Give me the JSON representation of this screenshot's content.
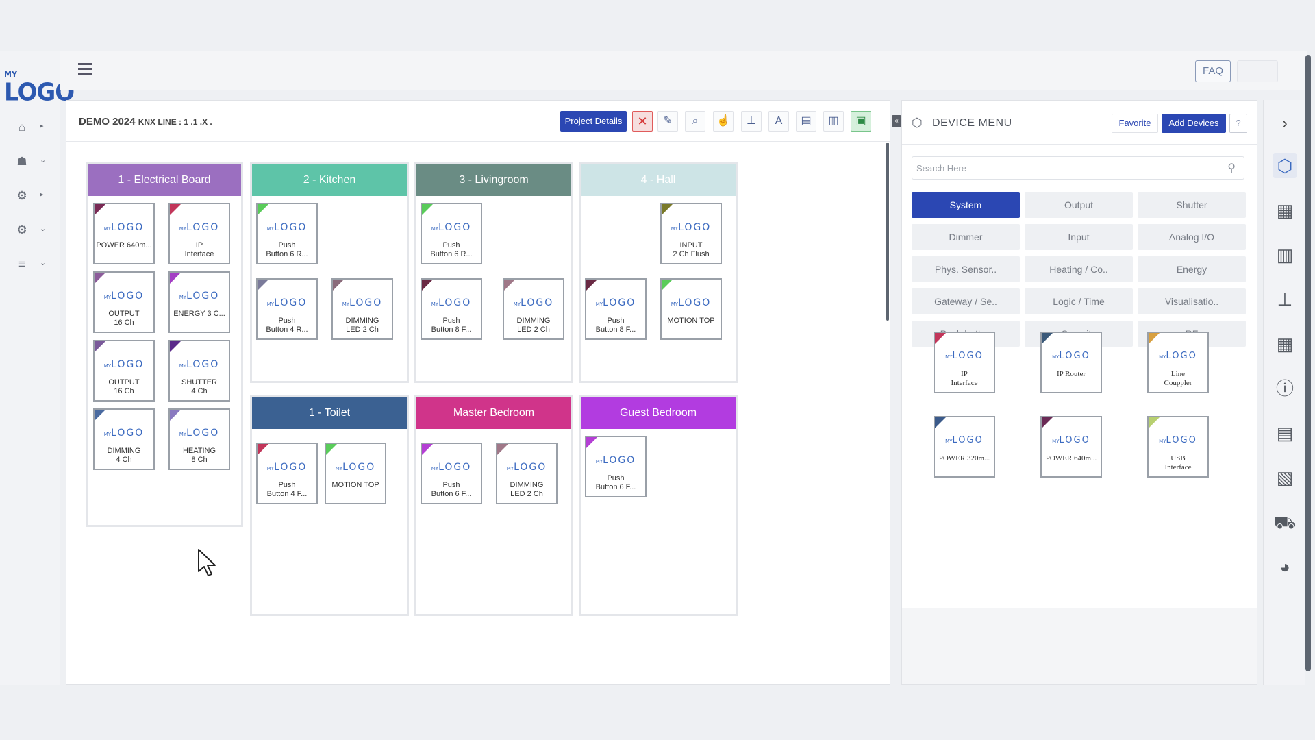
{
  "app": {
    "logo_prefix": "MY",
    "logo_text": "LOGO",
    "faq_label": "FAQ"
  },
  "project": {
    "name": "DEMO 2024",
    "line": "KNX LINE : 1 .1 .X ."
  },
  "toolbar": {
    "project_details_label": "Project Details",
    "close_glyph": "✕",
    "tools": [
      {
        "icon": "pencil-icon",
        "glyph": "✎"
      },
      {
        "icon": "search-icon",
        "glyph": "⌕"
      },
      {
        "icon": "hand-pointer-icon",
        "glyph": "☝"
      },
      {
        "icon": "hierarchy-icon",
        "glyph": "⊥"
      },
      {
        "icon": "text-icon",
        "glyph": "A"
      },
      {
        "icon": "document-icon",
        "glyph": "▤"
      },
      {
        "icon": "clipboard-icon",
        "glyph": "▥"
      },
      {
        "icon": "save-icon",
        "glyph": "▣"
      }
    ]
  },
  "rooms": [
    {
      "name": "1 - Electrical Board",
      "color": "#9b6fc0",
      "devices": [
        {
          "label": "POWER 640m...",
          "tri": "#7a2a55"
        },
        {
          "label": "IP\nInterface",
          "tri": "#c2365a"
        },
        {
          "label": "OUTPUT\n16 Ch",
          "tri": "#8c5c9a"
        },
        {
          "label": "ENERGY 3 C...",
          "tri": "#a43fc4"
        },
        {
          "label": "OUTPUT\n16 Ch",
          "tri": "#7a5a9a"
        },
        {
          "label": "SHUTTER\n4 Ch",
          "tri": "#5a2a8a"
        },
        {
          "label": "DIMMING\n4 Ch",
          "tri": "#4a6aa0"
        },
        {
          "label": "HEATING\n8 Ch",
          "tri": "#8a7ac0"
        }
      ]
    },
    {
      "name": "2 - Kitchen",
      "color": "#5ec4a8",
      "devices": [
        {
          "label": "Push\nButton 6 R...",
          "tri": "#5acc5a"
        },
        {
          "label": "Push\nButton 4 R...",
          "tri": "#7a7a9a"
        },
        {
          "label": "DIMMING\nLED 2 Ch",
          "tri": "#8a6a7a"
        }
      ]
    },
    {
      "name": "3 - Livingroom",
      "color": "#6a8c84",
      "devices": [
        {
          "label": "Push\nButton 6 R...",
          "tri": "#5acc5a"
        },
        {
          "label": "Push\nButton 8 F...",
          "tri": "#6a2a44"
        },
        {
          "label": "DIMMING\nLED 2 Ch",
          "tri": "#a07888"
        }
      ]
    },
    {
      "name": "4 - Hall",
      "color": "#cde4e6",
      "devices": [
        {
          "label": "INPUT\n2 Ch Flush",
          "tri": "#7a7a2a"
        },
        {
          "label": "Push\nButton 8 F...",
          "tri": "#6a2a44"
        },
        {
          "label": "MOTION TOP",
          "tri": "#5acc5a"
        }
      ]
    },
    {
      "name": "1 - Toilet",
      "color": "#3b6192",
      "devices": [
        {
          "label": "Push\nButton 4 F...",
          "tri": "#c2365a"
        },
        {
          "label": "MOTION TOP",
          "tri": "#5acc5a"
        }
      ]
    },
    {
      "name": "Master Bedroom",
      "color": "#d0348a",
      "devices": [
        {
          "label": "Push\nButton 6 F...",
          "tri": "#b43fd4"
        },
        {
          "label": "DIMMING\nLED 2 Ch",
          "tri": "#a07888"
        }
      ]
    },
    {
      "name": "Guest Bedroom",
      "color": "#b23ce0",
      "devices": [
        {
          "label": "Push\nButton 6 F...",
          "tri": "#b43fd4"
        }
      ]
    }
  ],
  "device_menu": {
    "title": "DEVICE MENU",
    "favorite_label": "Favorite",
    "add_devices_label": "Add Devices",
    "help_label": "?",
    "search_placeholder": "Search Here",
    "categories": [
      "System",
      "Output",
      "Shutter",
      "Dimmer",
      "Input",
      "Analog I/O",
      "Phys. Sensor..",
      "Heating / Co..",
      "Energy",
      "Gateway / Se..",
      "Logic / Time",
      "Visualisatio..",
      "Push button",
      "Security",
      "RF"
    ],
    "active_category": "System",
    "devices": [
      {
        "label": "IP\nInterface",
        "tri": "#c2365a"
      },
      {
        "label": "IP Router",
        "tri": "#3b5a7a"
      },
      {
        "label": "Line\nCouppler",
        "tri": "#d8a040"
      },
      {
        "label": "POWER 320m...",
        "tri": "#3b5a8a"
      },
      {
        "label": "POWER 640m...",
        "tri": "#6a2a55"
      },
      {
        "label": "USB\nInterface",
        "tri": "#b8d070"
      }
    ]
  },
  "left_nav": [
    {
      "icon": "dashboard-icon",
      "glyph": "⌂",
      "caret": "▸"
    },
    {
      "icon": "user-icon",
      "glyph": "☗",
      "caret": "⌄"
    },
    {
      "icon": "settings-check-icon",
      "glyph": "⚙",
      "caret": "▸"
    },
    {
      "icon": "gears-icon",
      "glyph": "⚙",
      "caret": "⌄"
    },
    {
      "icon": "list-icon",
      "glyph": "≡",
      "caret": "⌄"
    }
  ],
  "right_rail": [
    {
      "icon": "cube-icon",
      "glyph": "⬡",
      "active": true
    },
    {
      "icon": "cubes-icon",
      "glyph": "▦"
    },
    {
      "icon": "building-icon",
      "glyph": "▥"
    },
    {
      "icon": "sitemap-icon",
      "glyph": "⊥"
    },
    {
      "icon": "grid-icon",
      "glyph": "▦"
    },
    {
      "icon": "info-icon",
      "glyph": "ⓘ"
    },
    {
      "icon": "pdf-icon",
      "glyph": "▤"
    },
    {
      "icon": "excel-icon",
      "glyph": "▧"
    },
    {
      "icon": "cart-icon",
      "glyph": "⛟"
    },
    {
      "icon": "pie-chart-icon",
      "glyph": "◕"
    }
  ]
}
